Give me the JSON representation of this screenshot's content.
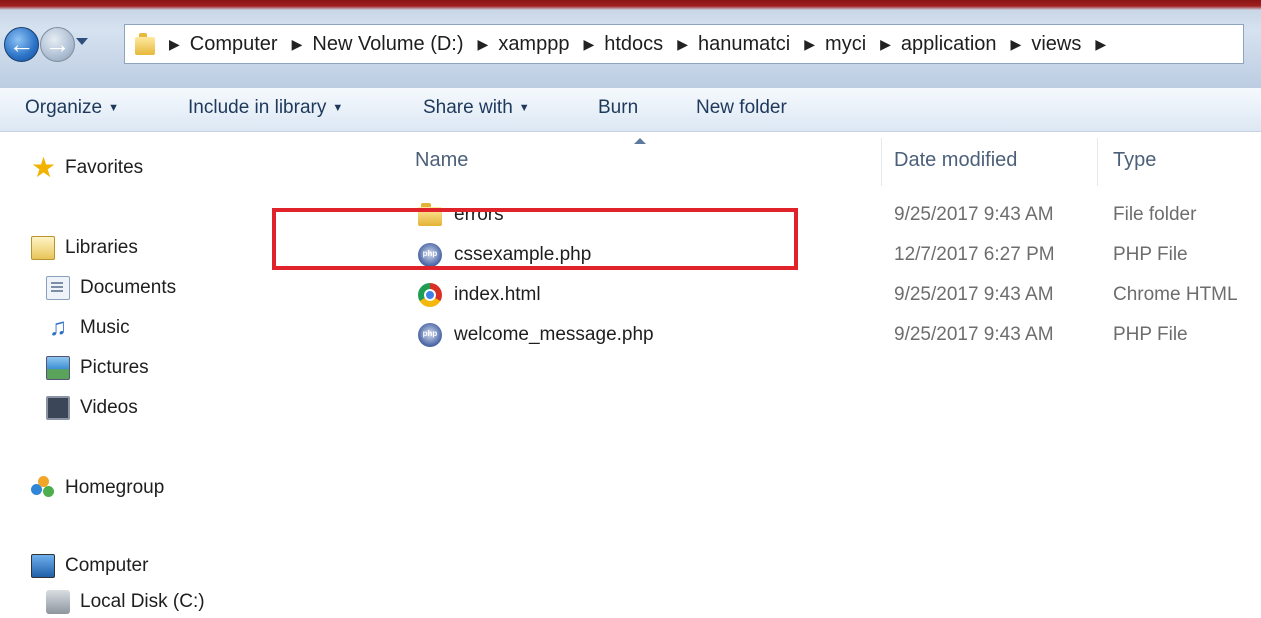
{
  "address_bar": {
    "breadcrumbs": [
      "Computer",
      "New Volume (D:)",
      "xamppp",
      "htdocs",
      "hanumatci",
      "myci",
      "application",
      "views"
    ]
  },
  "command_bar": {
    "organize": "Organize",
    "include_in_library": "Include in library",
    "share_with": "Share with",
    "burn": "Burn",
    "new_folder": "New folder"
  },
  "navigation": {
    "favorites": "Favorites",
    "libraries": "Libraries",
    "documents": "Documents",
    "music": "Music",
    "pictures": "Pictures",
    "videos": "Videos",
    "homegroup": "Homegroup",
    "computer": "Computer",
    "local_disk": "Local Disk (C:)"
  },
  "columns": {
    "name": "Name",
    "date_modified": "Date modified",
    "type": "Type"
  },
  "files": [
    {
      "name": "errors",
      "date": "9/25/2017 9:43 AM",
      "type": "File folder",
      "icon": "folder-icon"
    },
    {
      "name": "cssexample.php",
      "date": "12/7/2017 6:27 PM",
      "type": "PHP File",
      "icon": "php-file-icon"
    },
    {
      "name": "index.html",
      "date": "9/25/2017 9:43 AM",
      "type": "Chrome HTML",
      "icon": "chrome-icon"
    },
    {
      "name": "welcome_message.php",
      "date": "9/25/2017 9:43 AM",
      "type": "PHP File",
      "icon": "php-file-icon"
    }
  ],
  "colors": {
    "highlight_box": "#e0232a",
    "command_text": "#1e395b",
    "header_text": "#4c607a"
  }
}
